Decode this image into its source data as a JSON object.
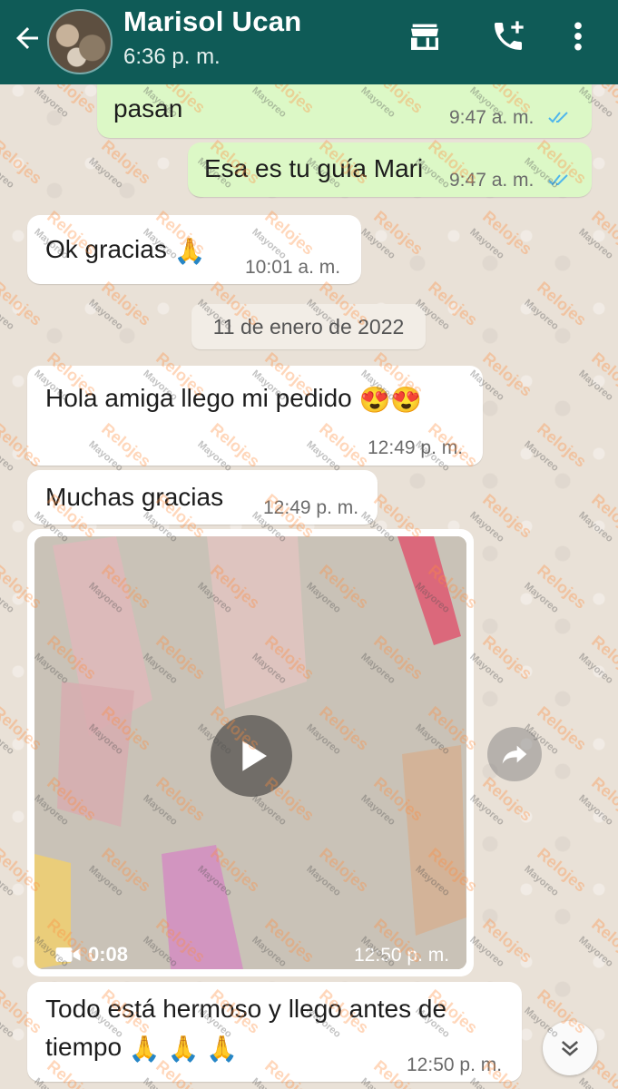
{
  "header": {
    "contact_name": "Marisol Ucan",
    "last_seen": "6:36 p. m.",
    "bg_color": "#0f5b57",
    "icons": [
      "back-arrow-icon",
      "store-icon",
      "add-call-icon",
      "more-vert-icon"
    ]
  },
  "messages": {
    "m1": {
      "text": "pasan",
      "time": "9:47 a. m.",
      "status": "read"
    },
    "m2": {
      "text": "Esa es tu guía Mari",
      "time": "9:47 a. m.",
      "status": "read"
    },
    "m3": {
      "text": "Ok gracias",
      "emoji": "🙏",
      "time": "10:01 a. m."
    },
    "date_separator": "11 de enero de 2022",
    "m4": {
      "text": "Hola amiga llego mi pedido",
      "emoji": "😍😍",
      "time": "12:49 p. m."
    },
    "m5": {
      "text": "Muchas gracias",
      "time": "12:49 p. m."
    },
    "video": {
      "duration": "0:08",
      "time": "12:50 p. m."
    },
    "m6": {
      "line1": "Todo está hermoso y llego antes de",
      "line2": "tiempo",
      "emoji": "🙏 🙏 🙏",
      "time": "12:50 p. m."
    }
  },
  "colors": {
    "outgoing": "#dcf8c6",
    "incoming": "#ffffff",
    "read_ticks": "#4fb6ec"
  },
  "watermark": {
    "text_top": "Relojes",
    "text_bottom": "Mayoreo"
  }
}
